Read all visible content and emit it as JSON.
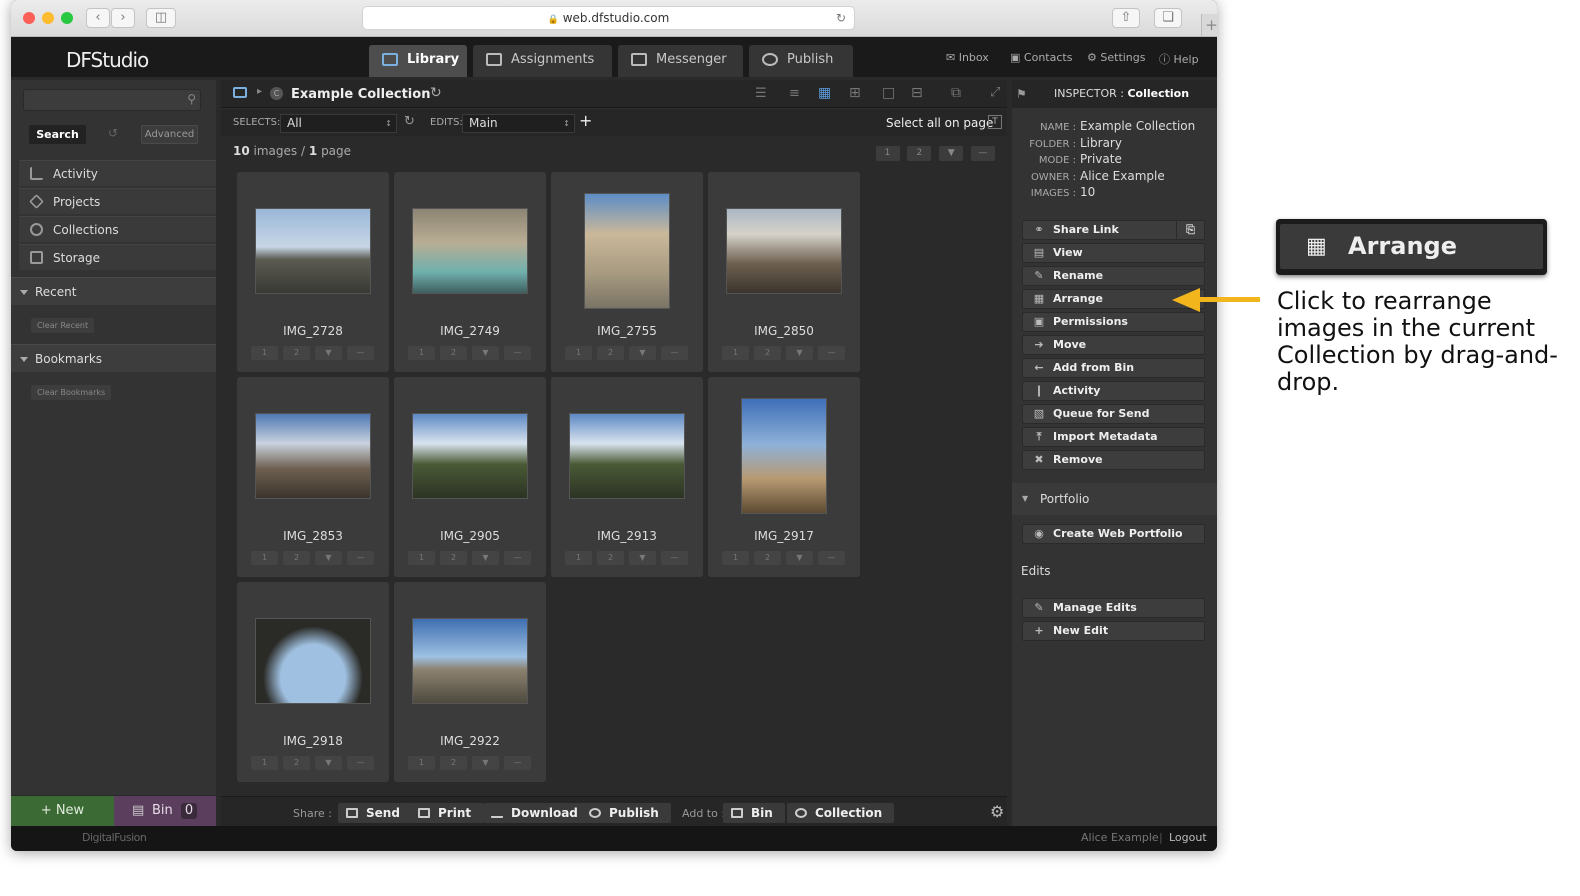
{
  "browser": {
    "url": "web.dfstudio.com"
  },
  "app": {
    "logo": "DFStudio"
  },
  "tabs": [
    {
      "label": "Library",
      "icon": "library-icon"
    },
    {
      "label": "Assignments",
      "icon": "assignments-icon"
    },
    {
      "label": "Messenger",
      "icon": "messenger-icon"
    },
    {
      "label": "Publish",
      "icon": "publish-icon"
    }
  ],
  "toplinks": {
    "inbox": "Inbox",
    "contacts": "Contacts",
    "settings": "Settings",
    "help": "Help"
  },
  "sidebar": {
    "search_label": "Search",
    "advanced_label": "Advanced",
    "items": [
      {
        "label": "Activity"
      },
      {
        "label": "Projects"
      },
      {
        "label": "Collections"
      },
      {
        "label": "Storage"
      }
    ],
    "recent": "Recent",
    "clear_recent": "Clear Recent",
    "bookmarks": "Bookmarks",
    "clear_bookmarks": "Clear Bookmarks",
    "new_label": "+ New",
    "bin_label": "Bin",
    "bin_count": "0"
  },
  "main": {
    "collection_title": "Example Collection",
    "selects_label": "SELECTS:",
    "selects_value": "All",
    "edits_label": "EDITS:",
    "edits_value": "Main",
    "select_all": "Select all on page",
    "count_images": "10",
    "count_images_word": "images",
    "count_sep": "/",
    "count_pages": "1",
    "count_pages_word": "page",
    "pages": [
      "1",
      "2"
    ],
    "rate_labels": [
      "1",
      "2",
      "—"
    ],
    "images": [
      {
        "name": "IMG_2728"
      },
      {
        "name": "IMG_2749"
      },
      {
        "name": "IMG_2755"
      },
      {
        "name": "IMG_2850"
      },
      {
        "name": "IMG_2853"
      },
      {
        "name": "IMG_2905"
      },
      {
        "name": "IMG_2913"
      },
      {
        "name": "IMG_2917"
      },
      {
        "name": "IMG_2918"
      },
      {
        "name": "IMG_2922"
      }
    ]
  },
  "footer": {
    "share_label": "Share :",
    "send": "Send",
    "print": "Print",
    "download": "Download",
    "publish": "Publish",
    "addto_label": "Add to :",
    "bin": "Bin",
    "collection": "Collection"
  },
  "inspector": {
    "title_prefix": "INSPECTOR :",
    "title": "Collection",
    "meta": [
      {
        "key": "NAME :",
        "value": "Example Collection"
      },
      {
        "key": "FOLDER :",
        "value": "Library"
      },
      {
        "key": "MODE :",
        "value": "Private"
      },
      {
        "key": "OWNER :",
        "value": "Alice Example"
      },
      {
        "key": "IMAGES :",
        "value": "10"
      }
    ],
    "actions": [
      {
        "label": "Share Link",
        "icon": "link-icon"
      },
      {
        "label": "View",
        "icon": "view-icon"
      },
      {
        "label": "Rename",
        "icon": "pencil-icon"
      },
      {
        "label": "Arrange",
        "icon": "grid-icon"
      },
      {
        "label": "Permissions",
        "icon": "lock-icon"
      },
      {
        "label": "Move",
        "icon": "arrow-right-icon"
      },
      {
        "label": "Add from Bin",
        "icon": "arrow-left-icon"
      },
      {
        "label": "Activity",
        "icon": "activity-icon"
      },
      {
        "label": "Queue for Send",
        "icon": "queue-icon"
      },
      {
        "label": "Import Metadata",
        "icon": "upload-icon"
      },
      {
        "label": "Remove",
        "icon": "x-icon"
      }
    ],
    "portfolio": "Portfolio",
    "create_portfolio": "Create Web Portfolio",
    "edits": "Edits",
    "manage_edits": "Manage Edits",
    "new_edit": "New Edit"
  },
  "bottom": {
    "brand": "DigitalFusion",
    "user": "Alice Example",
    "logout": "Logout"
  },
  "callout": {
    "button_label": "Arrange",
    "text": "Click to rearrange images in the current Collection by drag-and-drop."
  },
  "colors": {
    "accent_arrow": "#f2b51b",
    "new_green": "#3c6a35",
    "bin_purple": "#5b3d5e"
  }
}
